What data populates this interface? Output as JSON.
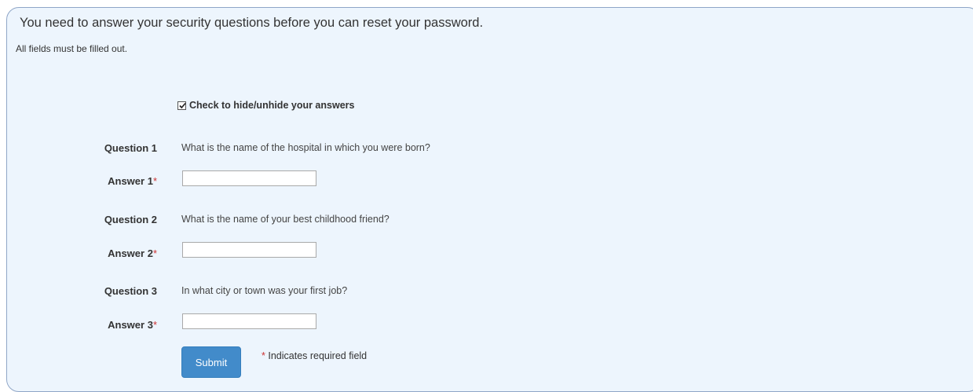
{
  "form": {
    "heading": "You need to answer your security questions before you can reset your password.",
    "subnote": "All fields must be filled out.",
    "toggle_label": "Check to hide/unhide your answers",
    "toggle_checked": true,
    "questions": [
      {
        "label": "Question 1",
        "text": "What is the name of the hospital in which you were born?",
        "answer_label": "Answer 1",
        "answer_value": ""
      },
      {
        "label": "Question 2",
        "text": "What is the name of your best childhood friend?",
        "answer_label": "Answer 2",
        "answer_value": ""
      },
      {
        "label": "Question 3",
        "text": "In what city or town was your first job?",
        "answer_label": "Answer 3",
        "answer_value": ""
      }
    ],
    "required_marker": "*",
    "submit_label": "Submit",
    "required_note": "Indicates required field"
  },
  "colors": {
    "panel_background": "#edf5fd",
    "panel_border": "#8fa6c7",
    "submit_background": "#428bca",
    "required_marker": "#cc3333"
  },
  "icons": {
    "toggle": "checkbox-checked-icon"
  }
}
